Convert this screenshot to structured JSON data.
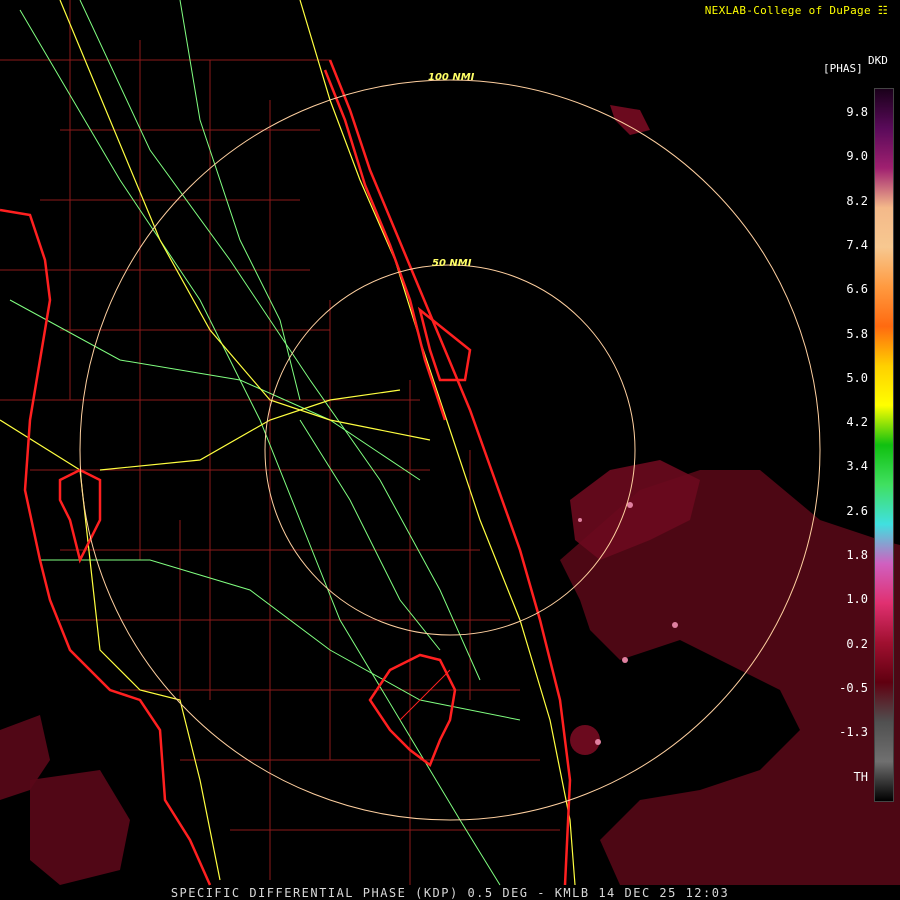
{
  "credit": "NEXLAB-College of DuPage",
  "credit_icon": "k-logo-icon",
  "product_abbrev": "DKD",
  "unit": "[PHAS]",
  "ring_labels": {
    "outer": "100 NMI",
    "inner": "50 NMI"
  },
  "footer": "SPECIFIC DIFFERENTIAL PHASE (KDP) 0.5 DEG - KMLB 14 DEC 25 12:03",
  "colorbar": {
    "ticks": [
      "9.8",
      "9.0",
      "8.2",
      "7.4",
      "6.6",
      "5.8",
      "5.0",
      "4.2",
      "3.4",
      "2.6",
      "1.8",
      "1.0",
      "0.2",
      "-0.5",
      "-1.3",
      "TH"
    ],
    "stops": [
      "#1a001a",
      "#5a0a5a",
      "#a02070",
      "#f4b98a",
      "#f7c890",
      "#ff9a40",
      "#ff6a10",
      "#ffd000",
      "#ffff00",
      "#10c010",
      "#40e060",
      "#40e0e0",
      "#d060c0",
      "#e03070",
      "#a01030",
      "#600010",
      "#505050",
      "#707070",
      "#000000"
    ]
  },
  "colors": {
    "background": "#000000",
    "coastline": "#ff2020",
    "county_lines": "#8b1a1a",
    "highways": "#ffff40",
    "roads": "#80ff80",
    "range_rings": "#ffd0a0",
    "echo": "#6b0a1e",
    "echo_light": "#c04070"
  }
}
